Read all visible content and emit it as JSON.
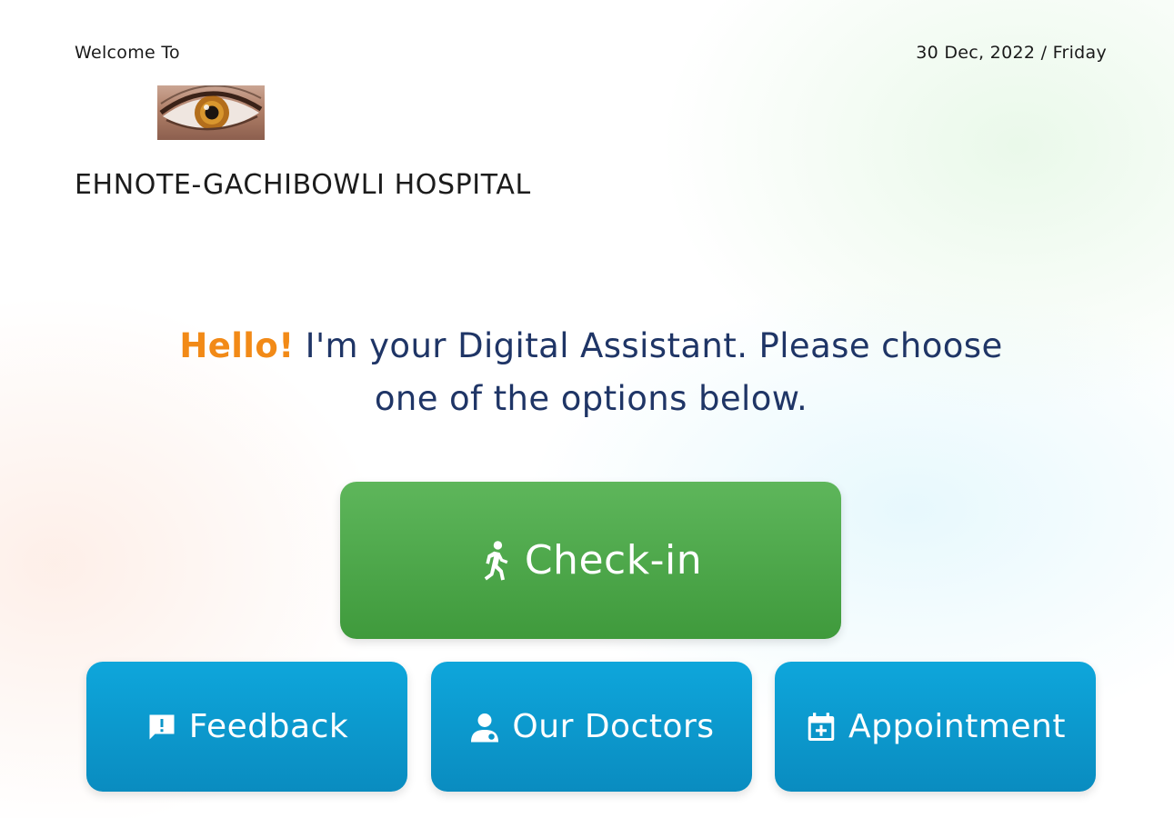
{
  "header": {
    "welcome_text": "Welcome To",
    "date_text": "30 Dec, 2022 / Friday",
    "hospital_name": "EHNOTE-GACHIBOWLI HOSPITAL",
    "logo_icon": "eye-logo"
  },
  "greeting": {
    "hello": "Hello!",
    "line1_rest": " I'm your Digital Assistant. Please choose",
    "line2": "one of the options below."
  },
  "actions": {
    "checkin": {
      "label": "Check-in",
      "icon": "walking-person-icon"
    },
    "feedback": {
      "label": "Feedback",
      "icon": "feedback-icon"
    },
    "doctors": {
      "label": "Our Doctors",
      "icon": "doctor-icon"
    },
    "appointment": {
      "label": "Appointment",
      "icon": "calendar-add-icon"
    }
  },
  "colors": {
    "accent_hello": "#f28a17",
    "text_navy": "#1f3566",
    "checkin_green": "#4caf50",
    "action_blue": "#0a9ad0"
  }
}
